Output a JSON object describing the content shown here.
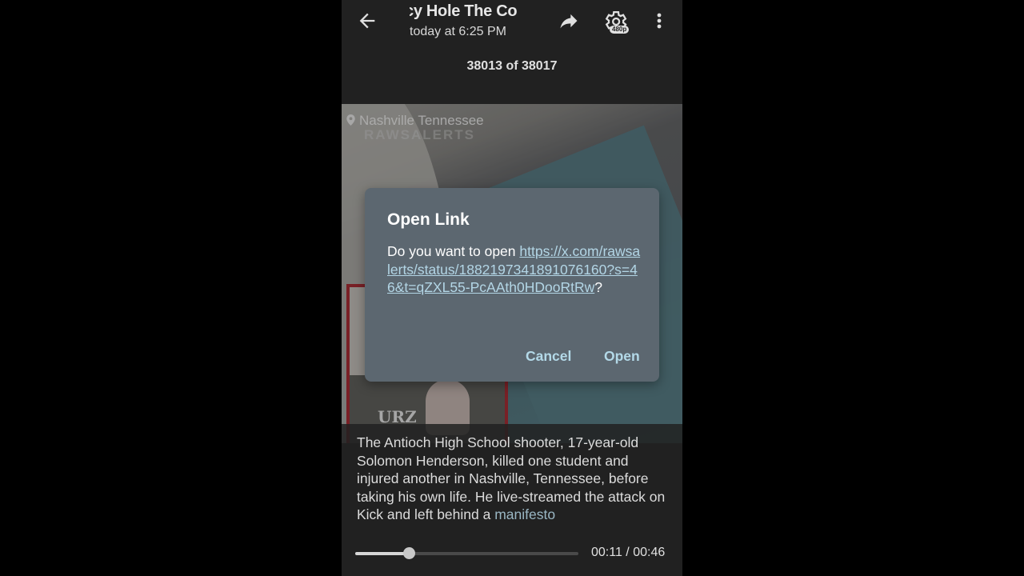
{
  "header": {
    "title": "Conspiracy Hole   The Co",
    "title_visible": "cy Hole   The Co",
    "subtitle": "today at 6:25 PM",
    "quality_badge": "480p",
    "counter": "38013 of 38017"
  },
  "media": {
    "location": "Nashville Tennessee",
    "watermark": "RAWSALERTS",
    "inset_logo": "URZ"
  },
  "dialog": {
    "title": "Open Link",
    "prompt": "Do you want to open ",
    "url": "https://x.com/rawsalerts/status/1882197341891076160?s=46&t=qZXL55-PcAAth0HDooRtRw",
    "suffix": "?",
    "cancel_label": "Cancel",
    "open_label": "Open"
  },
  "caption": {
    "text": "The Antioch High School shooter, 17-year-old Solomon Henderson, killed one student and injured another in Nashville, Tennessee, before taking his own life. He live-streamed the attack on Kick and left behind a ",
    "link": "manifesto"
  },
  "player": {
    "current_time": "00:11",
    "separator": " / ",
    "duration": "00:46",
    "progress_fraction": 0.239
  },
  "icons": {
    "back": "arrow-left-icon",
    "share": "share-icon",
    "settings": "gear-icon",
    "more": "more-vert-icon",
    "location": "location-pin-icon"
  }
}
